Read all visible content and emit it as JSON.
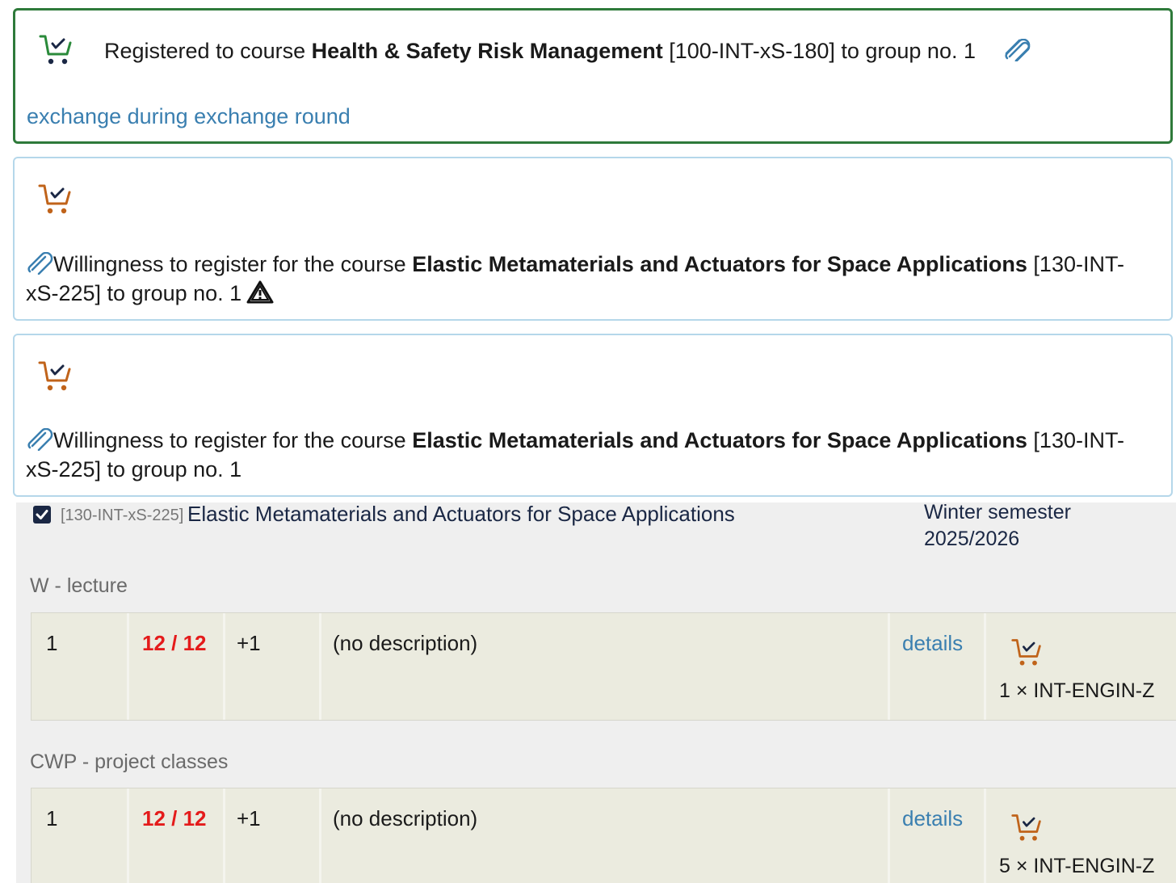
{
  "colors": {
    "green_border": "#2e7a3a",
    "blue_border": "#b5d7ea",
    "link": "#3a7fb0",
    "red": "#e41b1b",
    "orange_cart": "#c0631a",
    "green_cart": "#2a8a3a"
  },
  "entries": [
    {
      "icon": "cart-check-icon",
      "prefix": "Registered to course ",
      "course": "Health & Safety Risk Management",
      "suffix": " [100-INT-xS-180] to group no. 1",
      "link": "exchange during exchange round"
    },
    {
      "icon": "cart-check-icon",
      "prefix": "Willingness to register for the course ",
      "course": "Elastic Metamaterials and Actuators for Space Applications",
      "suffix_line1": " [130-INT-",
      "suffix_line2": "xS-225] to group no. 1",
      "warning_icon": "warning-icon"
    },
    {
      "icon": "cart-check-icon",
      "prefix": "Willingness to register for the course ",
      "course": "Elastic Metamaterials and Actuators for Space Applications",
      "suffix_line1": " [130-INT-",
      "suffix_line2": "xS-225] to group no. 1"
    }
  ],
  "course": {
    "code": "[130-INT-xS-225]",
    "name": "Elastic Metamaterials and Actuators for Space Applications",
    "semester": "Winter semester 2025/2026",
    "groups": [
      {
        "title": "W - lecture",
        "row": {
          "group_no": "1",
          "capacity": "12 / 12",
          "extra": "+1",
          "description": "(no description)",
          "details": "details",
          "package": "1 × INT-ENGIN-Z"
        }
      },
      {
        "title": "CWP - project classes",
        "row": {
          "group_no": "1",
          "capacity": "12 / 12",
          "extra": "+1",
          "description": "(no description)",
          "details": "details",
          "package": "5 × INT-ENGIN-Z"
        }
      }
    ]
  }
}
